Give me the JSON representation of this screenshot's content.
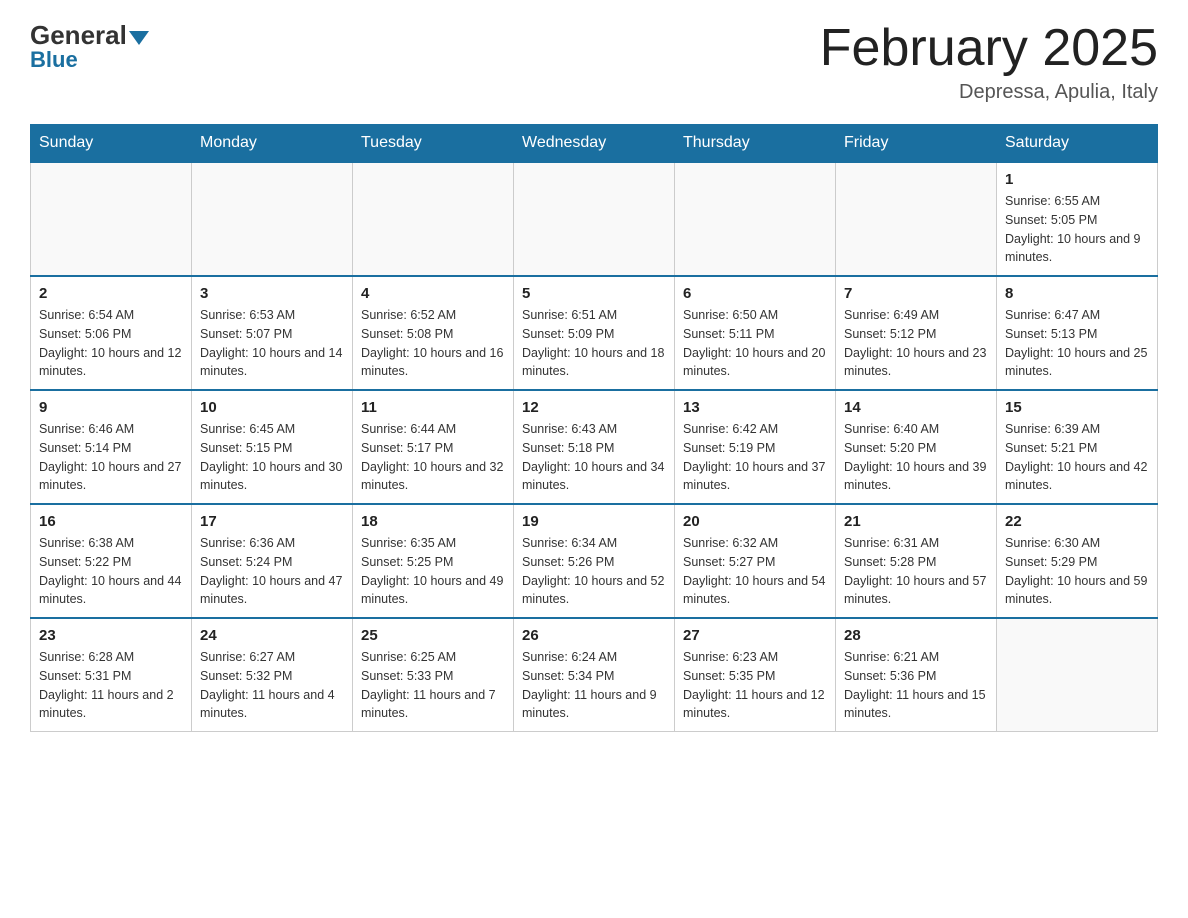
{
  "header": {
    "logo_general": "General",
    "logo_blue": "Blue",
    "month_title": "February 2025",
    "location": "Depressa, Apulia, Italy"
  },
  "days_of_week": [
    "Sunday",
    "Monday",
    "Tuesday",
    "Wednesday",
    "Thursday",
    "Friday",
    "Saturday"
  ],
  "weeks": [
    [
      {
        "day": "",
        "info": ""
      },
      {
        "day": "",
        "info": ""
      },
      {
        "day": "",
        "info": ""
      },
      {
        "day": "",
        "info": ""
      },
      {
        "day": "",
        "info": ""
      },
      {
        "day": "",
        "info": ""
      },
      {
        "day": "1",
        "info": "Sunrise: 6:55 AM\nSunset: 5:05 PM\nDaylight: 10 hours and 9 minutes."
      }
    ],
    [
      {
        "day": "2",
        "info": "Sunrise: 6:54 AM\nSunset: 5:06 PM\nDaylight: 10 hours and 12 minutes."
      },
      {
        "day": "3",
        "info": "Sunrise: 6:53 AM\nSunset: 5:07 PM\nDaylight: 10 hours and 14 minutes."
      },
      {
        "day": "4",
        "info": "Sunrise: 6:52 AM\nSunset: 5:08 PM\nDaylight: 10 hours and 16 minutes."
      },
      {
        "day": "5",
        "info": "Sunrise: 6:51 AM\nSunset: 5:09 PM\nDaylight: 10 hours and 18 minutes."
      },
      {
        "day": "6",
        "info": "Sunrise: 6:50 AM\nSunset: 5:11 PM\nDaylight: 10 hours and 20 minutes."
      },
      {
        "day": "7",
        "info": "Sunrise: 6:49 AM\nSunset: 5:12 PM\nDaylight: 10 hours and 23 minutes."
      },
      {
        "day": "8",
        "info": "Sunrise: 6:47 AM\nSunset: 5:13 PM\nDaylight: 10 hours and 25 minutes."
      }
    ],
    [
      {
        "day": "9",
        "info": "Sunrise: 6:46 AM\nSunset: 5:14 PM\nDaylight: 10 hours and 27 minutes."
      },
      {
        "day": "10",
        "info": "Sunrise: 6:45 AM\nSunset: 5:15 PM\nDaylight: 10 hours and 30 minutes."
      },
      {
        "day": "11",
        "info": "Sunrise: 6:44 AM\nSunset: 5:17 PM\nDaylight: 10 hours and 32 minutes."
      },
      {
        "day": "12",
        "info": "Sunrise: 6:43 AM\nSunset: 5:18 PM\nDaylight: 10 hours and 34 minutes."
      },
      {
        "day": "13",
        "info": "Sunrise: 6:42 AM\nSunset: 5:19 PM\nDaylight: 10 hours and 37 minutes."
      },
      {
        "day": "14",
        "info": "Sunrise: 6:40 AM\nSunset: 5:20 PM\nDaylight: 10 hours and 39 minutes."
      },
      {
        "day": "15",
        "info": "Sunrise: 6:39 AM\nSunset: 5:21 PM\nDaylight: 10 hours and 42 minutes."
      }
    ],
    [
      {
        "day": "16",
        "info": "Sunrise: 6:38 AM\nSunset: 5:22 PM\nDaylight: 10 hours and 44 minutes."
      },
      {
        "day": "17",
        "info": "Sunrise: 6:36 AM\nSunset: 5:24 PM\nDaylight: 10 hours and 47 minutes."
      },
      {
        "day": "18",
        "info": "Sunrise: 6:35 AM\nSunset: 5:25 PM\nDaylight: 10 hours and 49 minutes."
      },
      {
        "day": "19",
        "info": "Sunrise: 6:34 AM\nSunset: 5:26 PM\nDaylight: 10 hours and 52 minutes."
      },
      {
        "day": "20",
        "info": "Sunrise: 6:32 AM\nSunset: 5:27 PM\nDaylight: 10 hours and 54 minutes."
      },
      {
        "day": "21",
        "info": "Sunrise: 6:31 AM\nSunset: 5:28 PM\nDaylight: 10 hours and 57 minutes."
      },
      {
        "day": "22",
        "info": "Sunrise: 6:30 AM\nSunset: 5:29 PM\nDaylight: 10 hours and 59 minutes."
      }
    ],
    [
      {
        "day": "23",
        "info": "Sunrise: 6:28 AM\nSunset: 5:31 PM\nDaylight: 11 hours and 2 minutes."
      },
      {
        "day": "24",
        "info": "Sunrise: 6:27 AM\nSunset: 5:32 PM\nDaylight: 11 hours and 4 minutes."
      },
      {
        "day": "25",
        "info": "Sunrise: 6:25 AM\nSunset: 5:33 PM\nDaylight: 11 hours and 7 minutes."
      },
      {
        "day": "26",
        "info": "Sunrise: 6:24 AM\nSunset: 5:34 PM\nDaylight: 11 hours and 9 minutes."
      },
      {
        "day": "27",
        "info": "Sunrise: 6:23 AM\nSunset: 5:35 PM\nDaylight: 11 hours and 12 minutes."
      },
      {
        "day": "28",
        "info": "Sunrise: 6:21 AM\nSunset: 5:36 PM\nDaylight: 11 hours and 15 minutes."
      },
      {
        "day": "",
        "info": ""
      }
    ]
  ]
}
